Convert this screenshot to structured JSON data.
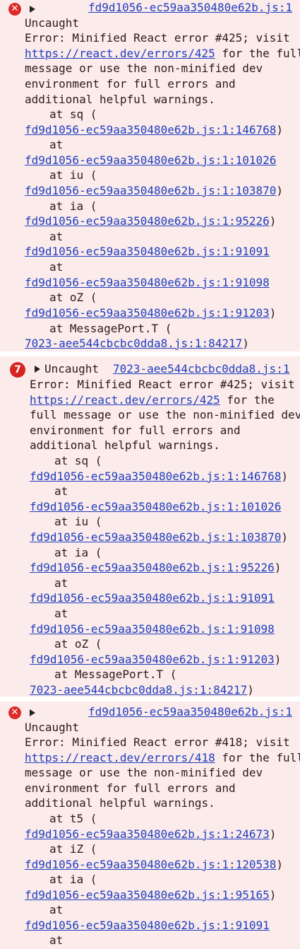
{
  "entries": [
    {
      "repeat": "",
      "source": "fd9d1056-ec59aa350480e62b.js:1",
      "title": "Uncaught",
      "msg1": "Error: Minified React error #425; visit",
      "url": "https://react.dev/errors/425",
      "msg1b": " for the full",
      "msg2": "message or use the non-minified dev",
      "msg3": "environment for full errors and",
      "msg4": "additional helpful warnings.",
      "stack": [
        {
          "pre": "at sq (",
          "loc": "fd9d1056-ec59aa350480e62b.js:1:146768",
          "post": ")"
        },
        {
          "pre": "at",
          "loc": "fd9d1056-ec59aa350480e62b.js:1:101026",
          "post": ""
        },
        {
          "pre": "at iu (",
          "loc": "fd9d1056-ec59aa350480e62b.js:1:103870",
          "post": ")"
        },
        {
          "pre": "at ia (",
          "loc": "fd9d1056-ec59aa350480e62b.js:1:95226",
          "post": ")"
        },
        {
          "pre": "at",
          "loc": "fd9d1056-ec59aa350480e62b.js:1:91091",
          "post": ""
        },
        {
          "pre": "at",
          "loc": "fd9d1056-ec59aa350480e62b.js:1:91098",
          "post": ""
        },
        {
          "pre": "at oZ (",
          "loc": "fd9d1056-ec59aa350480e62b.js:1:91203",
          "post": ")"
        },
        {
          "pre": "at MessagePort.T (",
          "loc": "7023-aee544cbcbc0dda8.js:1:84217",
          "post": ")"
        }
      ]
    },
    {
      "repeat": "7",
      "source": "7023-aee544cbcbc0dda8.js:1",
      "title": "Uncaught",
      "msg1": "Error: Minified React error #425; visit",
      "url": "https://react.dev/errors/425",
      "msg1b": " for the",
      "msg2": "full message or use the non-minified dev",
      "msg3": "environment for full errors and",
      "msg4": "additional helpful warnings.",
      "stack": [
        {
          "pre": "at sq (",
          "loc": "fd9d1056-ec59aa350480e62b.js:1:146768",
          "post": ")"
        },
        {
          "pre": "at",
          "loc": "fd9d1056-ec59aa350480e62b.js:1:101026",
          "post": ""
        },
        {
          "pre": "at iu (",
          "loc": "fd9d1056-ec59aa350480e62b.js:1:103870",
          "post": ")"
        },
        {
          "pre": "at ia (",
          "loc": "fd9d1056-ec59aa350480e62b.js:1:95226",
          "post": ")"
        },
        {
          "pre": "at",
          "loc": "fd9d1056-ec59aa350480e62b.js:1:91091",
          "post": ""
        },
        {
          "pre": "at",
          "loc": "fd9d1056-ec59aa350480e62b.js:1:91098",
          "post": ""
        },
        {
          "pre": "at oZ (",
          "loc": "fd9d1056-ec59aa350480e62b.js:1:91203",
          "post": ")"
        },
        {
          "pre": "at MessagePort.T (",
          "loc": "7023-aee544cbcbc0dda8.js:1:84217",
          "post": ")"
        }
      ]
    },
    {
      "repeat": "",
      "source": "fd9d1056-ec59aa350480e62b.js:1",
      "title": "Uncaught",
      "msg1": "Error: Minified React error #418; visit",
      "url": "https://react.dev/errors/418",
      "msg1b": " for the full",
      "msg2": "message or use the non-minified dev",
      "msg3": "environment for full errors and",
      "msg4": "additional helpful warnings.",
      "stack": [
        {
          "pre": "at t5 (",
          "loc": "fd9d1056-ec59aa350480e62b.js:1:24673",
          "post": ")"
        },
        {
          "pre": "at iZ (",
          "loc": "fd9d1056-ec59aa350480e62b.js:1:120538",
          "post": ")"
        },
        {
          "pre": "at ia (",
          "loc": "fd9d1056-ec59aa350480e62b.js:1:95165",
          "post": ")"
        },
        {
          "pre": "at",
          "loc": "fd9d1056-ec59aa350480e62b.js:1:91091",
          "post": ""
        },
        {
          "pre": "at",
          "loc": "",
          "post": ""
        }
      ]
    }
  ]
}
